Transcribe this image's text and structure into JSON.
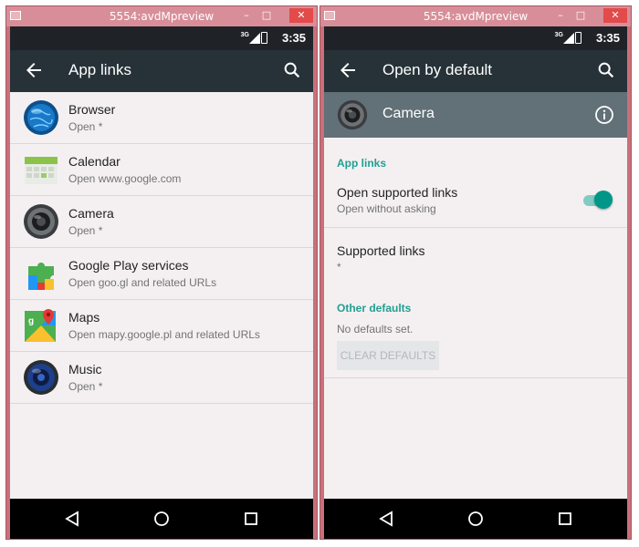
{
  "left_window": {
    "title": "5554:avdMpreview",
    "status": {
      "network": "3G",
      "time": "3:35"
    },
    "appbar": {
      "title": "App links"
    },
    "apps": [
      {
        "name": "Browser",
        "subtitle": "Open *",
        "icon": "browser-globe-icon"
      },
      {
        "name": "Calendar",
        "subtitle": "Open www.google.com",
        "icon": "calendar-icon"
      },
      {
        "name": "Camera",
        "subtitle": "Open *",
        "icon": "camera-icon"
      },
      {
        "name": "Google Play services",
        "subtitle": "Open goo.gl and related URLs",
        "icon": "play-services-icon"
      },
      {
        "name": "Maps",
        "subtitle": "Open mapy.google.pl and related URLs",
        "icon": "maps-icon"
      },
      {
        "name": "Music",
        "subtitle": "Open *",
        "icon": "music-speaker-icon"
      }
    ]
  },
  "right_window": {
    "title": "5554:avdMpreview",
    "status": {
      "network": "3G",
      "time": "3:35"
    },
    "appbar": {
      "title": "Open by default"
    },
    "app_header": {
      "name": "Camera"
    },
    "sections": {
      "app_links_heading": "App links",
      "open_supported_links": {
        "title": "Open supported links",
        "subtitle": "Open without asking",
        "enabled": true
      },
      "supported_links": {
        "title": "Supported links",
        "value": "*"
      },
      "other_defaults_heading": "Other defaults",
      "no_defaults_text": "No defaults set.",
      "clear_defaults_label": "CLEAR DEFAULTS"
    }
  },
  "colors": {
    "window_frame": "#c9707a",
    "status_bar": "#1f2328",
    "app_bar": "#263238",
    "header_strip": "#627077",
    "accent": "#20a090",
    "toggle_thumb": "#009688"
  }
}
